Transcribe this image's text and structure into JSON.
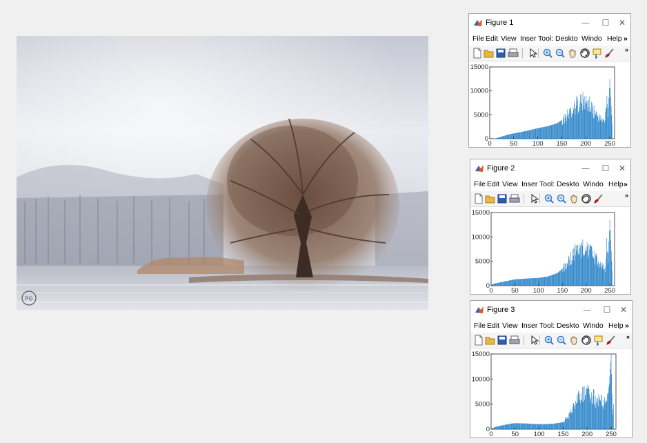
{
  "photo": {
    "alt": "",
    "watermark": "PG"
  },
  "menu": [
    "File",
    "Edit",
    "View",
    "Inser",
    "Tool:",
    "Deskto",
    "Windo",
    "Help"
  ],
  "colors": {
    "bar": "#1f7dc6",
    "accent": "#0072bd",
    "window_border": "#a6a6a6",
    "background": "#f0f0f0"
  },
  "toolbar_icons": [
    "new-figure-icon",
    "open-file-icon",
    "save-icon",
    "print-icon",
    "pointer-icon",
    "zoom-in-icon",
    "zoom-out-icon",
    "pan-icon",
    "rotate-3d-icon",
    "data-cursor-icon",
    "brush-icon",
    "more-icon"
  ],
  "figures": [
    {
      "title": "Figure 1",
      "controls": {
        "minimize": "—",
        "maximize": "☐",
        "close": "✕"
      },
      "chart_data": {
        "type": "bar",
        "xlim": [
          0,
          260
        ],
        "ylim": [
          0,
          15000
        ],
        "xticks": [
          0,
          50,
          100,
          150,
          200,
          250
        ],
        "yticks": [
          0,
          5000,
          10000,
          15000
        ],
        "grid": false,
        "profile": [
          [
            0,
            0
          ],
          [
            10,
            0
          ],
          [
            20,
            300
          ],
          [
            30,
            600
          ],
          [
            40,
            900
          ],
          [
            60,
            1300
          ],
          [
            80,
            1700
          ],
          [
            100,
            2200
          ],
          [
            120,
            2600
          ],
          [
            140,
            3200
          ],
          [
            150,
            3900
          ],
          [
            160,
            4800
          ],
          [
            170,
            6200
          ],
          [
            180,
            7200
          ],
          [
            190,
            8000
          ],
          [
            200,
            7800
          ],
          [
            210,
            7000
          ],
          [
            220,
            5500
          ],
          [
            230,
            4200
          ],
          [
            240,
            3600
          ],
          [
            244,
            10000
          ],
          [
            246,
            4500
          ],
          [
            250,
            12500
          ],
          [
            255,
            3000
          ]
        ]
      }
    },
    {
      "title": "Figure 2",
      "controls": {
        "minimize": "—",
        "maximize": "☐",
        "close": "✕"
      },
      "chart_data": {
        "type": "bar",
        "xlim": [
          0,
          260
        ],
        "ylim": [
          0,
          15000
        ],
        "xticks": [
          0,
          50,
          100,
          150,
          200,
          250
        ],
        "yticks": [
          0,
          5000,
          10000,
          15000
        ],
        "grid": false,
        "profile": [
          [
            0,
            0
          ],
          [
            3,
            300
          ],
          [
            10,
            500
          ],
          [
            30,
            900
          ],
          [
            50,
            1300
          ],
          [
            80,
            1500
          ],
          [
            100,
            1600
          ],
          [
            120,
            1900
          ],
          [
            140,
            2600
          ],
          [
            150,
            3500
          ],
          [
            160,
            4800
          ],
          [
            170,
            6200
          ],
          [
            180,
            7400
          ],
          [
            190,
            7900
          ],
          [
            200,
            7600
          ],
          [
            210,
            6800
          ],
          [
            220,
            5600
          ],
          [
            230,
            4300
          ],
          [
            240,
            3800
          ],
          [
            244,
            9500
          ],
          [
            246,
            4600
          ],
          [
            250,
            13500
          ],
          [
            255,
            3000
          ]
        ]
      }
    },
    {
      "title": "Figure 3",
      "controls": {
        "minimize": "—",
        "maximize": "☐",
        "close": "✕"
      },
      "chart_data": {
        "type": "bar",
        "xlim": [
          0,
          260
        ],
        "ylim": [
          0,
          15000
        ],
        "xticks": [
          0,
          50,
          100,
          150,
          200,
          250
        ],
        "yticks": [
          0,
          5000,
          10000,
          15000
        ],
        "grid": false,
        "profile": [
          [
            0,
            0
          ],
          [
            3,
            200
          ],
          [
            10,
            500
          ],
          [
            25,
            800
          ],
          [
            40,
            1100
          ],
          [
            50,
            1200
          ],
          [
            70,
            1150
          ],
          [
            90,
            1050
          ],
          [
            110,
            1000
          ],
          [
            130,
            1100
          ],
          [
            150,
            1400
          ],
          [
            160,
            2600
          ],
          [
            170,
            4200
          ],
          [
            180,
            6000
          ],
          [
            190,
            6800
          ],
          [
            200,
            7200
          ],
          [
            210,
            6600
          ],
          [
            220,
            6000
          ],
          [
            230,
            5600
          ],
          [
            240,
            5200
          ],
          [
            246,
            9000
          ],
          [
            250,
            15000
          ],
          [
            253,
            3000
          ],
          [
            256,
            6000
          ]
        ]
      }
    }
  ]
}
